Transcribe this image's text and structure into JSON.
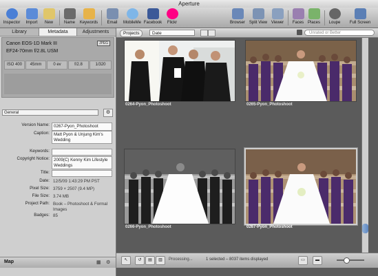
{
  "window": {
    "title": "Aperture"
  },
  "toolbar": {
    "left": [
      {
        "label": "Inspector",
        "icon": "info-icon",
        "color": "#4a7fd6"
      },
      {
        "label": "Import",
        "icon": "import-arrow-icon",
        "color": "#5b8bd8"
      },
      {
        "label": "New",
        "icon": "new-project-icon",
        "color": "#e0c66a"
      },
      {
        "label": "Name",
        "icon": "person-icon",
        "color": "#6a6a6a"
      },
      {
        "label": "Keywords",
        "icon": "keywords-tag-icon",
        "color": "#e7b34a"
      }
    ],
    "share": [
      {
        "label": "Email",
        "icon": "email-icon",
        "color": "#7a8fb0"
      },
      {
        "label": "MobileMe",
        "icon": "mobileme-icon",
        "color": "#7fb6e8"
      },
      {
        "label": "Facebook",
        "icon": "facebook-icon",
        "color": "#3b5998"
      },
      {
        "label": "Flickr",
        "icon": "flickr-icon",
        "color": "#ff0084"
      }
    ],
    "right": [
      {
        "label": "Browser",
        "icon": "browser-grid-icon",
        "color": "#6a88b8"
      },
      {
        "label": "Split View",
        "icon": "split-view-icon",
        "color": "#7c93b4"
      },
      {
        "label": "Viewer",
        "icon": "viewer-icon",
        "color": "#8aa0bf"
      },
      {
        "label": "Faces",
        "icon": "faces-icon",
        "color": "#9a7fb0"
      },
      {
        "label": "Places",
        "icon": "places-map-icon",
        "color": "#7ab36a"
      },
      {
        "label": "Loupe",
        "icon": "loupe-icon",
        "color": "#666666"
      },
      {
        "label": "Full Screen",
        "icon": "full-screen-icon",
        "color": "#5b7fb5"
      }
    ]
  },
  "inspector": {
    "tabs": [
      "Library",
      "Metadata",
      "Adjustments"
    ],
    "active_tab": "Metadata",
    "camera": {
      "model": "Canon EOS-1D Mark III",
      "lens": "EF24-70mm f/2.8L USM",
      "format": "JPEG"
    },
    "exif_cells": [
      "ISO 400",
      "45mm",
      "0 ev",
      "f/2.8",
      "1/320"
    ],
    "preset": "General",
    "fields": [
      {
        "key": "Version Name:",
        "value": "0267-Pyon_Photoshoot",
        "style": "box"
      },
      {
        "key": "Caption:",
        "value": "Matt Pyon & Unjung Kim's Wedding",
        "style": "box"
      },
      {
        "key": "Keywords:",
        "value": "",
        "style": "box"
      },
      {
        "key": "Copyright Notice:",
        "value": "2009(C) Kenny Kim Lifestyle Weddings",
        "style": "box"
      },
      {
        "key": "Title:",
        "value": "",
        "style": "box"
      },
      {
        "key": "Date:",
        "value": "12/5/09 1:43:29 PM PST",
        "style": "plain"
      },
      {
        "key": "Pixel Size:",
        "value": "3759 × 2507 (9.4 MP)",
        "style": "plain"
      },
      {
        "key": "File Size:",
        "value": "3.74 MB",
        "style": "plain"
      },
      {
        "key": "Project Path:",
        "value": "Book – Photoshoot & Formal Images",
        "style": "plain"
      },
      {
        "key": "Badges:",
        "value": "85",
        "style": "plain"
      }
    ],
    "map_label": "Map"
  },
  "browser": {
    "projects_button": "Projects",
    "sort": "Date",
    "search_placeholder": "Unrated or Better",
    "thumbs": [
      {
        "caption": "0264-Pyon_Photoshoot",
        "selected": false
      },
      {
        "caption": "0265-Pyon_Photoshoot",
        "selected": false
      },
      {
        "caption": "0266-Pyon_Photoshoot",
        "selected": false
      },
      {
        "caption": "0267-Pyon_Photoshoot",
        "selected": true
      }
    ],
    "status": {
      "processing": "Processing...",
      "count": "1 selected – 8037 items displayed"
    }
  }
}
